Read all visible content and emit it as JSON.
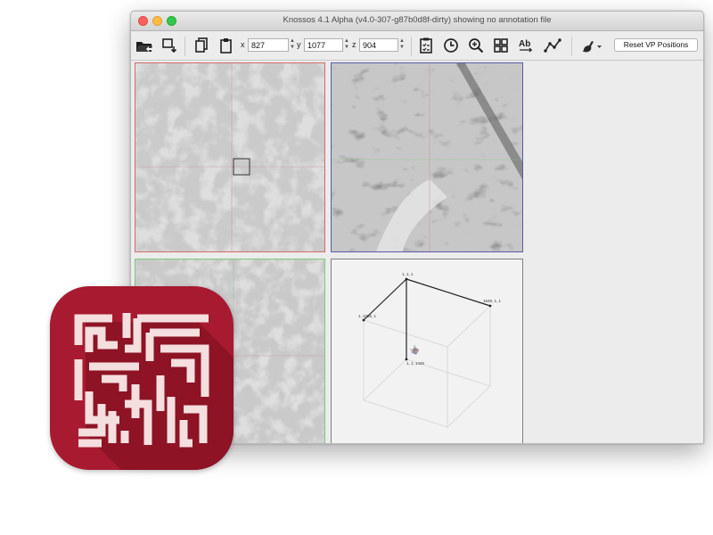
{
  "window": {
    "title": "Knossos 4.1 Alpha (v4.0-307-g87b0d8f-dirty) showing no annotation file"
  },
  "toolbar": {
    "icons": [
      "open-folder-icon",
      "save-dropdown-icon",
      "copy-icon",
      "paste-icon",
      "task-clipboard-icon",
      "clock-icon",
      "zoom-icon",
      "grid-icon",
      "text-ab-icon",
      "skeleton-line-icon",
      "brush-icon"
    ],
    "x_label": "x",
    "x_value": "827",
    "y_label": "y",
    "y_value": "1077",
    "z_label": "z",
    "z_value": "904",
    "reset_label": "Reset VP Positions"
  },
  "viewports": {
    "xy_border": "#d46a6a",
    "xz_border": "#5a5aa8",
    "yz_border": "#7acb7a",
    "skeleton_border": "#808080",
    "skeleton_labels": {
      "origin": "1, 1, 1",
      "x_end": "1549, 1, 1",
      "y_end": "1, 1092, 1",
      "z_end": "1, 1, 1440"
    }
  },
  "app_icon": {
    "name": "knossos-app-icon",
    "bg_color": "#a81a30",
    "maze_color": "#f4dede"
  }
}
